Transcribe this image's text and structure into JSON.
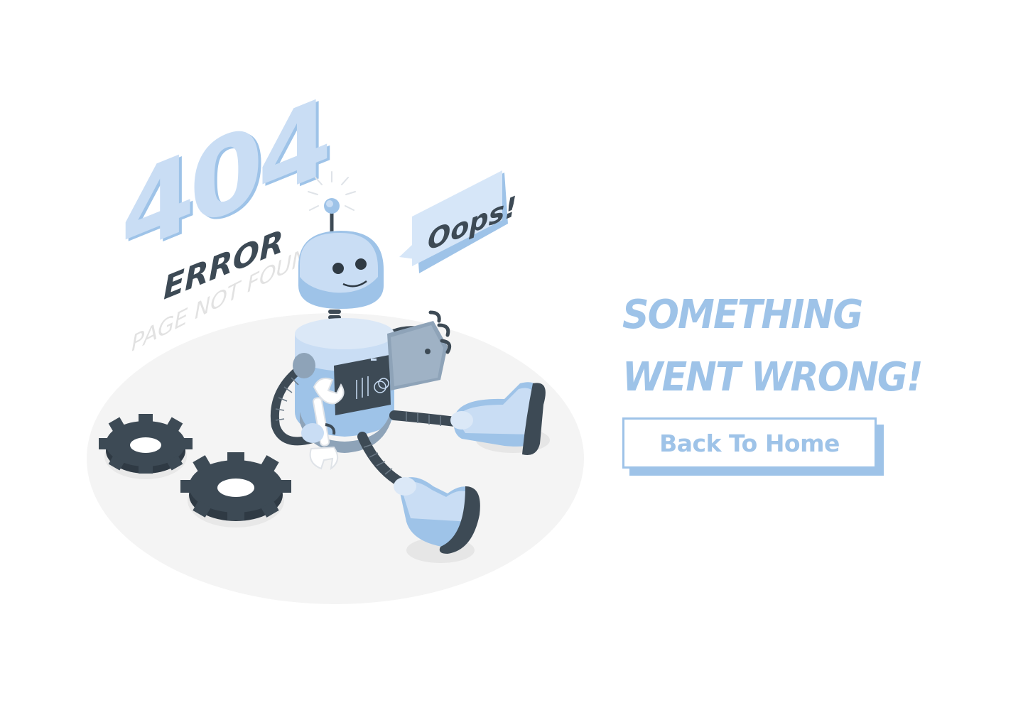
{
  "illustration": {
    "code": "404",
    "error_label": "ERROR",
    "subtitle": "PAGE NOT FOUND",
    "bubble_text": "Oops!"
  },
  "message": {
    "line1": "SOMETHING",
    "line2": "WENT WRONG!"
  },
  "actions": {
    "back_label": "Back To Home"
  },
  "colors": {
    "accent": "#9ec3e8",
    "dark": "#3d4a55",
    "light_blue": "#c9ddf4",
    "floor": "#f4f4f4",
    "muted_text": "#e2e2e2"
  },
  "icons": [
    "robot-icon",
    "gear-icon",
    "gear-icon",
    "wrench-icon",
    "speech-bubble-icon"
  ]
}
